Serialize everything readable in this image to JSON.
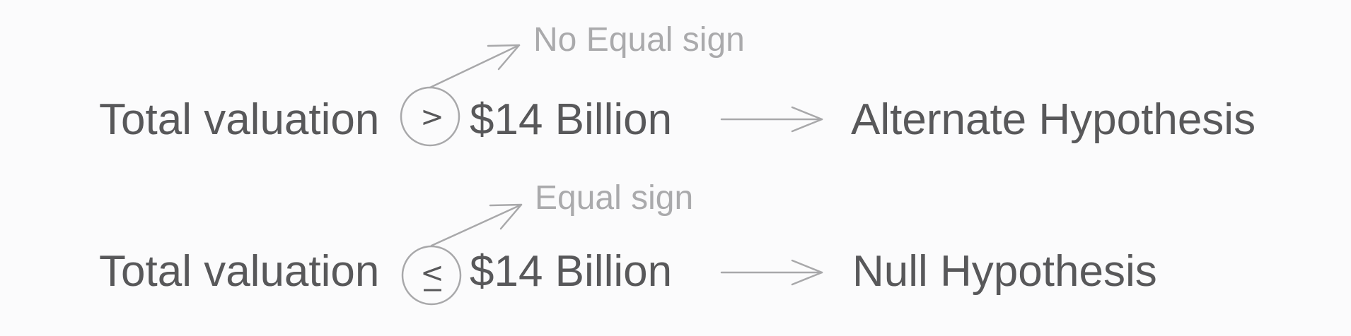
{
  "rows": [
    {
      "lhs": "Total valuation",
      "operator": ">",
      "rhs": "$14 Billion",
      "annotation": "No Equal sign",
      "result": "Alternate Hypothesis"
    },
    {
      "lhs": "Total valuation",
      "operator": "<",
      "rhs": "$14 Billion",
      "annotation": "Equal sign",
      "result": "Null Hypothesis"
    }
  ],
  "colors": {
    "main_text": "#58585a",
    "annotation_text": "#aaaaac",
    "lines": "#a8a8aa",
    "background": "#fbfbfc"
  },
  "icons": [
    "right-arrow-icon",
    "annotation-arrow-icon",
    "operator-circle-icon"
  ]
}
